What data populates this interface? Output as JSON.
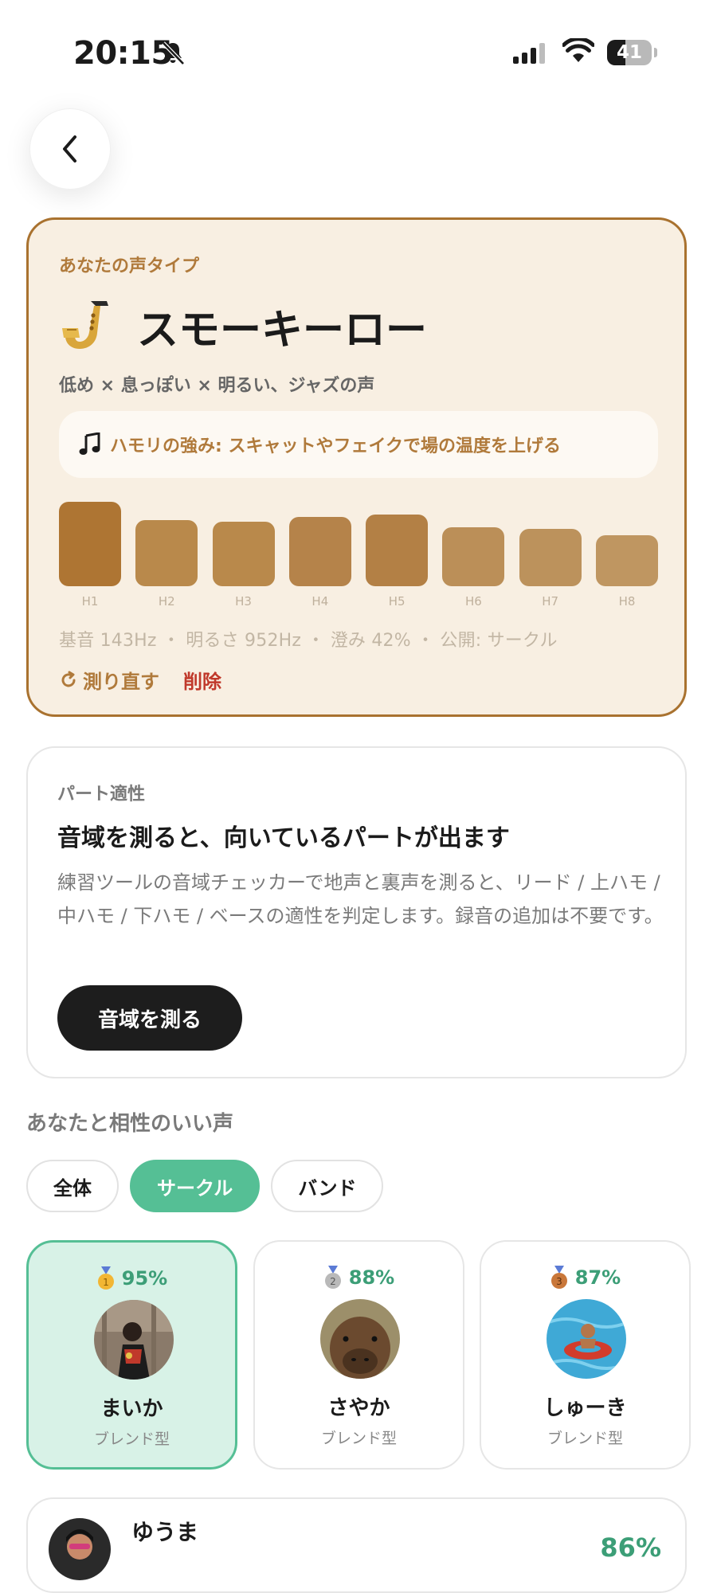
{
  "status_bar": {
    "time": "20:15",
    "battery": "41",
    "battery_level": 0.41
  },
  "voice_card": {
    "eyebrow": "あなたの声タイプ",
    "emoji": "saxophone-emoji",
    "title": "スモーキーロー",
    "subtitle": "低め × 息っぽい × 明るい、ジャズの声",
    "harmony_text": "ハモリの強み: スキャットやフェイクで場の温度を上げる",
    "harmonics": [
      {
        "label": "H1",
        "level": 1.0,
        "color": "#ae7533"
      },
      {
        "label": "H2",
        "level": 0.78,
        "color": "#b9894b"
      },
      {
        "label": "H3",
        "level": 0.76,
        "color": "#b9894b"
      },
      {
        "label": "H4",
        "level": 0.82,
        "color": "#b5834a"
      },
      {
        "label": "H5",
        "level": 0.85,
        "color": "#b38045"
      },
      {
        "label": "H6",
        "level": 0.7,
        "color": "#bb8f58"
      },
      {
        "label": "H7",
        "level": 0.68,
        "color": "#bc925c"
      },
      {
        "label": "H8",
        "level": 0.6,
        "color": "#bf9661"
      }
    ],
    "meta": "基音 143Hz ・ 明るさ 952Hz ・ 澄み 42% ・ 公開: サークル",
    "remeasure_label": "測り直す",
    "delete_label": "削除"
  },
  "part_card": {
    "eyebrow": "パート適性",
    "title": "音域を測ると、向いているパートが出ます",
    "body": "練習ツールの音域チェッカーで地声と裏声を測ると、リード / 上ハモ / 中ハモ / 下ハモ / ベースの適性を判定します。録音の追加は不要です。",
    "button_label": "音域を測る"
  },
  "compatibility": {
    "title": "あなたと相性のいい声",
    "filters": [
      "全体",
      "サークル",
      "バンド"
    ],
    "active_filter": "サークル",
    "top_matches": [
      {
        "rank": 1,
        "percent": "95%",
        "name": "まいか",
        "type": "ブレンド型"
      },
      {
        "rank": 2,
        "percent": "88%",
        "name": "さやか",
        "type": "ブレンド型"
      },
      {
        "rank": 3,
        "percent": "87%",
        "name": "しゅーき",
        "type": "ブレンド型"
      }
    ],
    "list": [
      {
        "name": "ゆうま",
        "percent": "86%"
      }
    ]
  },
  "colors": {
    "accent_green": "#55bf95",
    "accent_brown": "#a9722f",
    "delete_red": "#c0392b"
  }
}
